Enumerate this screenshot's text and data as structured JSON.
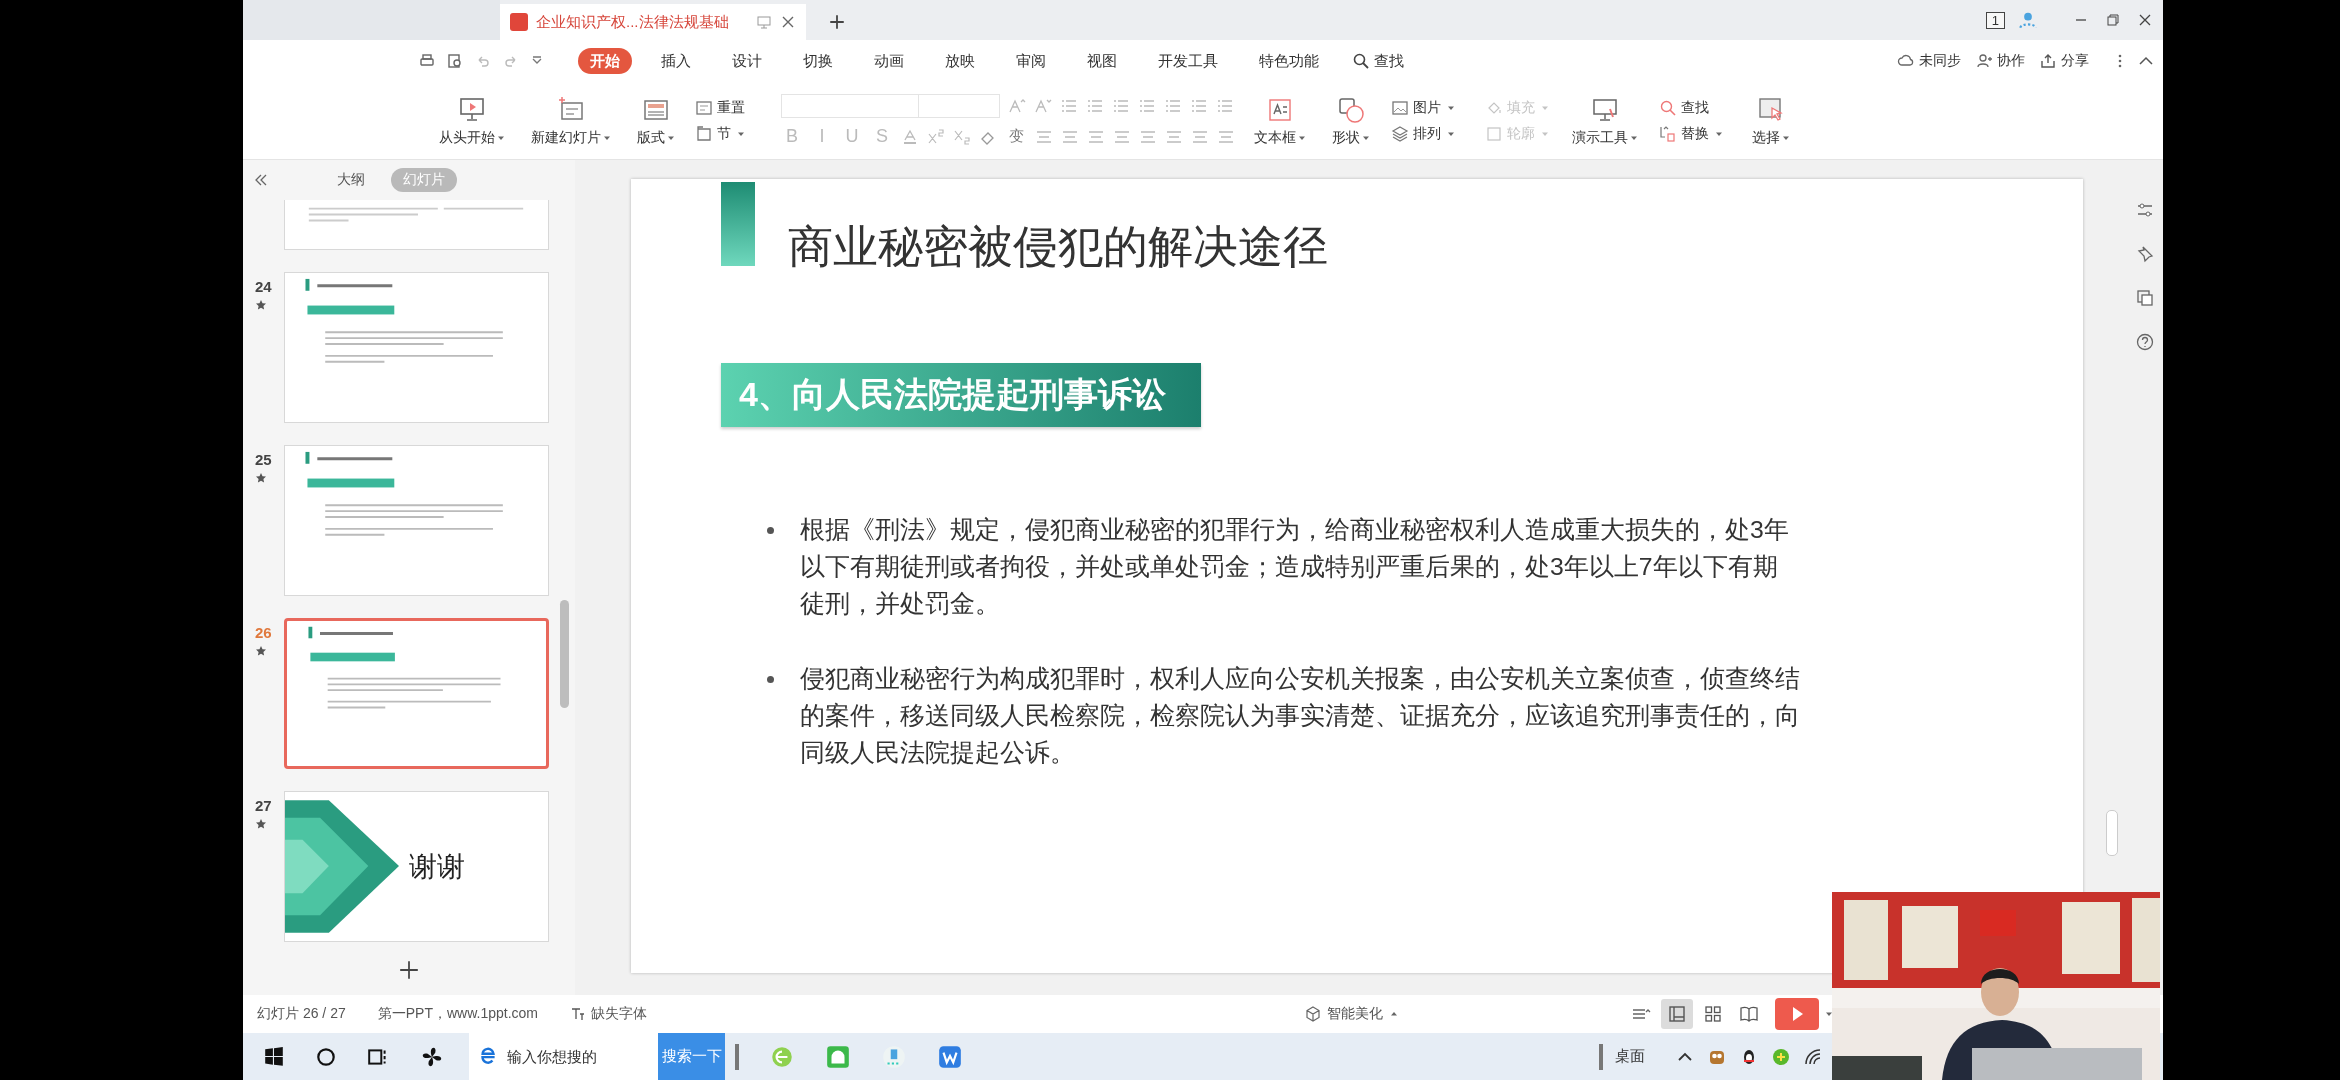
{
  "title_bar": {
    "tab_title": "企业知识产权...法律法规基础",
    "page_badge": "1"
  },
  "menu": {
    "tabs": [
      {
        "label": "开始",
        "selected": true
      },
      {
        "label": "插入",
        "selected": false
      },
      {
        "label": "设计",
        "selected": false
      },
      {
        "label": "切换",
        "selected": false
      },
      {
        "label": "动画",
        "selected": false
      },
      {
        "label": "放映",
        "selected": false
      },
      {
        "label": "审阅",
        "selected": false
      },
      {
        "label": "视图",
        "selected": false
      },
      {
        "label": "开发工具",
        "selected": false
      },
      {
        "label": "特色功能",
        "selected": false
      }
    ],
    "search": "查找",
    "actions": [
      "未同步",
      "协作",
      "分享"
    ]
  },
  "ribbon": {
    "start_show": "从头开始",
    "new_slide": "新建幻灯片",
    "layout": "版式",
    "reset": "重置",
    "section": "节",
    "format_letters": [
      "B",
      "I",
      "U",
      "S"
    ],
    "variant": "变",
    "text_box": "文本框",
    "shape": "形状",
    "picture": "图片",
    "arrange": "排列",
    "fill": {
      "label": "填充",
      "disabled": true
    },
    "outline": {
      "label": "轮廓",
      "disabled": true
    },
    "presenter_tools": "演示工具",
    "find": "查找",
    "replace": "替换",
    "select": "选择"
  },
  "sidebar": {
    "tabs": [
      {
        "label": "大纲",
        "selected": false
      },
      {
        "label": "幻灯片",
        "selected": true
      }
    ],
    "slides": [
      {
        "kind": "cut",
        "selected": false
      },
      {
        "kind": "content",
        "number": "24",
        "selected": false
      },
      {
        "kind": "content",
        "number": "25",
        "selected": false
      },
      {
        "kind": "content",
        "number": "26",
        "selected": true
      },
      {
        "kind": "closing",
        "number": "27",
        "title": "谢谢",
        "selected": false
      }
    ]
  },
  "slide": {
    "title": "商业秘密被侵犯的解决途径",
    "heading": "4、向人民法院提起刑事诉讼",
    "bullets": [
      "根据《刑法》规定，侵犯商业秘密的犯罪行为，给商业秘密权利人造成重大损失的，处3年以下有期徒刑或者拘役，并处或单处罚金；造成特别严重后果的，处3年以上7年以下有期徒刑，并处罚金。",
      "侵犯商业秘密行为构成犯罪时，权利人应向公安机关报案，由公安机关立案侦查，侦查终结的案件，移送同级人民检察院，检察院认为事实清楚、证据充分，应该追究刑事责任的，向同级人民法院提起公诉。"
    ]
  },
  "status_bar": {
    "slide_count": "幻灯片 26 / 27",
    "template_credit": "第一PPT，www.1ppt.com",
    "missing_fonts": "缺失字体",
    "beautify": "智能美化",
    "views": [
      {
        "selected": true
      },
      {
        "selected": false
      },
      {
        "selected": false
      }
    ]
  },
  "taskbar": {
    "search_placeholder": "输入你想搜的",
    "search_button": "搜索一下",
    "desktop": "桌面"
  }
}
